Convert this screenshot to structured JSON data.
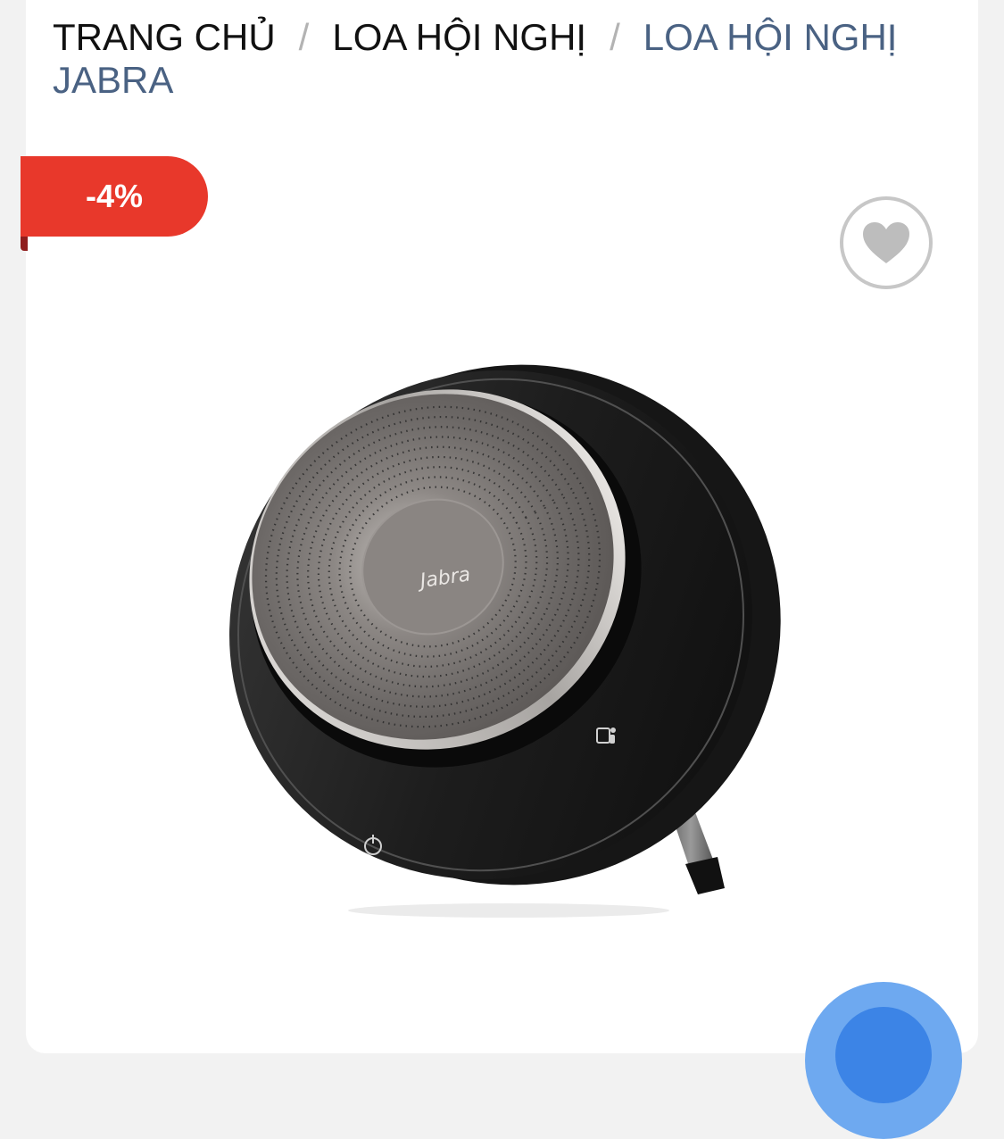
{
  "breadcrumb": {
    "home": "TRANG CHỦ",
    "category": "LOA HỘI NGHỊ",
    "current": "LOA HỘI NGHỊ JABRA",
    "separator": "/"
  },
  "product": {
    "discount_badge": "-4%",
    "image_brand_text": "Jabra",
    "wishlist_icon": "heart-icon",
    "power_icon": "power-icon",
    "teams_icon": "teams-icon"
  },
  "fab": {
    "icon": "chat-icon"
  },
  "colors": {
    "badge": "#e8382b",
    "breadcrumb_current": "#4a6283",
    "fab": "#6ea9f0"
  }
}
